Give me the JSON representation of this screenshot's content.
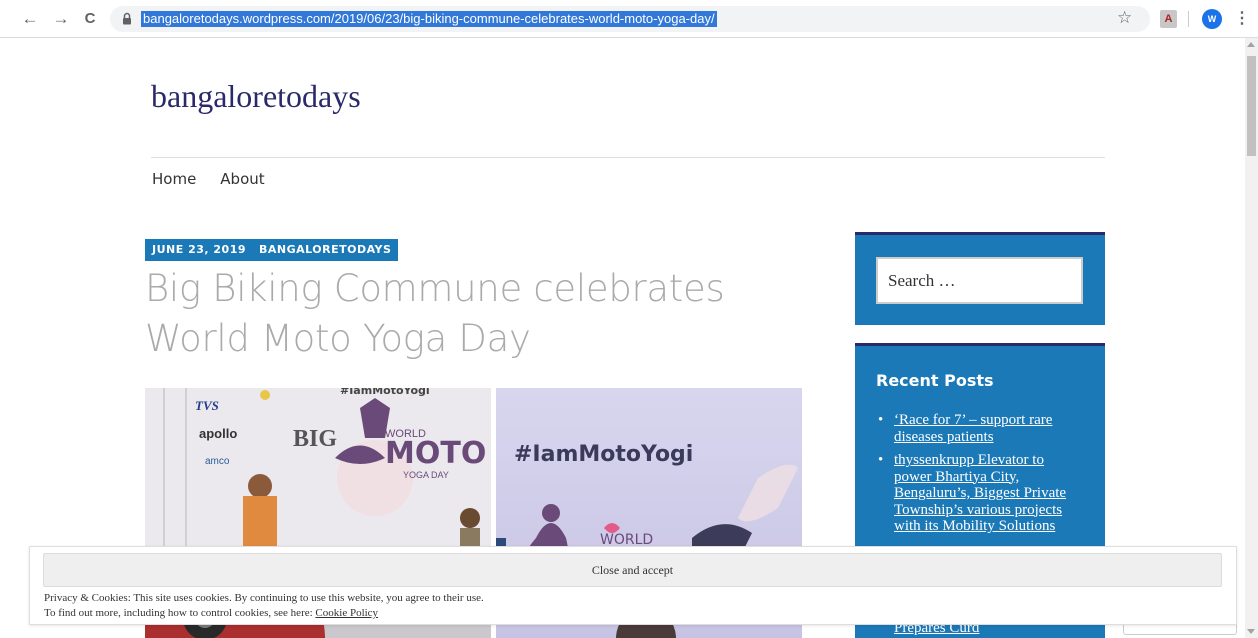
{
  "browser": {
    "url": "bangaloretodays.wordpress.com/2019/06/23/big-biking-commune-celebrates-world-moto-yoga-day/",
    "back_icon": "←",
    "forward_icon": "→",
    "reload_icon": "C",
    "star_icon": "☆",
    "pdf_icon": "A",
    "profile_initial": "W",
    "menu_icon": "⋮"
  },
  "site": {
    "title": "bangaloretodays",
    "nav": [
      "Home",
      "About"
    ]
  },
  "post": {
    "date_tag": "JUNE 23, 2019",
    "category_tag": "BANGALORETODAYS",
    "title": "Big Biking Commune celebrates World Moto Yoga Day",
    "image_left": {
      "hashtag": "#IamMotoYogi",
      "logos": [
        "TVS",
        "apollo",
        "amco"
      ],
      "big_text": "BIG",
      "world": "WORLD",
      "moto": "MOTO",
      "yoga_day": "YOGA DAY"
    },
    "image_right": {
      "hashtag": "#IamMotoYogi",
      "world": "WORLD"
    }
  },
  "sidebar": {
    "search_placeholder": "Search …",
    "recent_posts_title": "Recent Posts",
    "recent_posts": [
      "‘Race for 7’ – support rare diseases patients",
      "thyssenkrupp Elevator to power Bhartiya City, Bengaluru’s, Biggest Private Township’s various projects with its Mobility Solutions"
    ],
    "recent_partial": "Prepares Curd"
  },
  "cookie_banner": {
    "close_label": "Close and accept",
    "line1": "Privacy & Cookies: This site uses cookies. By continuing to use this website, you agree to their use.",
    "line2_prefix": "To find out more, including how to control cookies, see here: ",
    "policy_link": "Cookie Policy"
  },
  "colors": {
    "accent_blue": "#1b79b8",
    "title_navy": "#2a2a6a",
    "url_highlight": "#3178d8"
  }
}
